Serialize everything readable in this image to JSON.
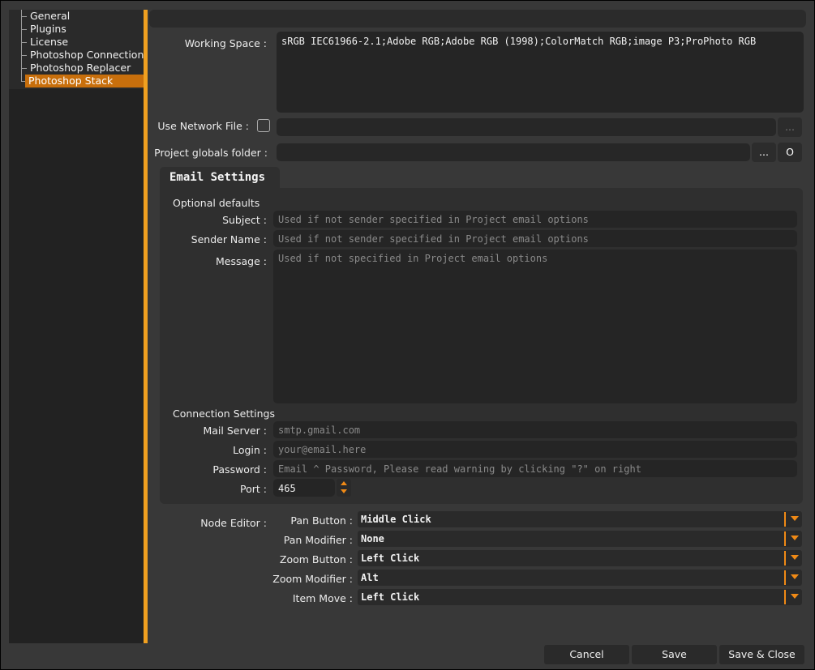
{
  "sidebar": {
    "items": [
      {
        "label": "General"
      },
      {
        "label": "Plugins"
      },
      {
        "label": "License"
      },
      {
        "label": "Photoshop Connection"
      },
      {
        "label": "Photoshop Replacer"
      },
      {
        "label": "Photoshop Stack",
        "selected": true
      }
    ]
  },
  "working_space": {
    "label": "Working Space :",
    "value": "sRGB IEC61966-2.1;Adobe RGB;Adobe RGB (1998);ColorMatch RGB;image P3;ProPhoto RGB"
  },
  "network_file": {
    "label": "Use Network File :",
    "checked": false,
    "value": "",
    "browse_label": "..."
  },
  "globals_folder": {
    "label": "Project globals folder :",
    "value": "",
    "browse_label": "...",
    "open_label": "O"
  },
  "email": {
    "tab_label": "Email Settings",
    "optional_defaults": "Optional defaults",
    "subject_label": "Subject :",
    "subject_placeholder": "Used if not sender specified in Project email options",
    "sender_label": "Sender Name :",
    "sender_placeholder": "Used if not sender specified in Project email options",
    "message_label": "Message :",
    "message_placeholder": "Used if not specified in Project email options",
    "connection_settings": "Connection Settings",
    "server_label": "Mail Server :",
    "server_placeholder": "smtp.gmail.com",
    "login_label": "Login :",
    "login_placeholder": "your@email.here",
    "password_label": "Password :",
    "password_placeholder": "Email ^ Password, Please read warning by clicking \"?\" on right",
    "port_label": "Port :",
    "port_value": "465"
  },
  "node_editor": {
    "label": "Node Editor :",
    "pan_button_label": "Pan Button :",
    "pan_button_value": "Middle Click",
    "pan_modifier_label": "Pan Modifier :",
    "pan_modifier_value": "None",
    "zoom_button_label": "Zoom Button :",
    "zoom_button_value": "Left Click",
    "zoom_modifier_label": "Zoom Modifier :",
    "zoom_modifier_value": "Alt",
    "item_move_label": "Item Move :",
    "item_move_value": "Left Click"
  },
  "footer": {
    "cancel_label": "Cancel",
    "save_label": "Save",
    "save_close_label": "Save & Close"
  },
  "colors": {
    "accent": "#f0a020",
    "selection": "#c86f0c",
    "dropdown_accent": "#f08a16"
  }
}
